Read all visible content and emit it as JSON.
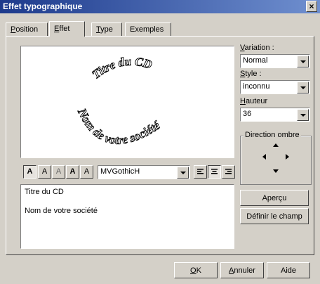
{
  "window": {
    "title": "Effet typographique",
    "close": "×"
  },
  "tabs": [
    {
      "label": "Position",
      "underline": "P",
      "rest": "osition"
    },
    {
      "label": "Effet",
      "underline": "E",
      "rest": "ffet"
    },
    {
      "label": "Type",
      "underline": "T",
      "rest": "ype"
    },
    {
      "label": "Exemples",
      "underline": "",
      "rest": "Exemples"
    }
  ],
  "preview": {
    "top_text": "Titre du CD",
    "bottom_text": "Nom de votre société"
  },
  "variation": {
    "label_u": "V",
    "label_rest": "ariation :",
    "value": "Normal"
  },
  "style": {
    "label_u": "S",
    "label_rest": "tyle :",
    "value": "inconnu"
  },
  "hauteur": {
    "label_u": "H",
    "label_rest": "auteur",
    "value": "36"
  },
  "shadow": {
    "label": "Direction ombre"
  },
  "toolbar": {
    "font": "MVGothicH",
    "style_buttons": [
      "A",
      "A",
      "A",
      "A",
      "A"
    ],
    "align_buttons": [
      "left",
      "center",
      "right"
    ]
  },
  "textbox": {
    "line1": "Titre du CD",
    "line2": "Nom de votre société"
  },
  "buttons": {
    "apercu": "Aperçu",
    "definir": "Définir le champ",
    "ok_u": "O",
    "ok_rest": "K",
    "annuler_u": "A",
    "annuler_rest": "nnuler",
    "aide": "Aide"
  }
}
